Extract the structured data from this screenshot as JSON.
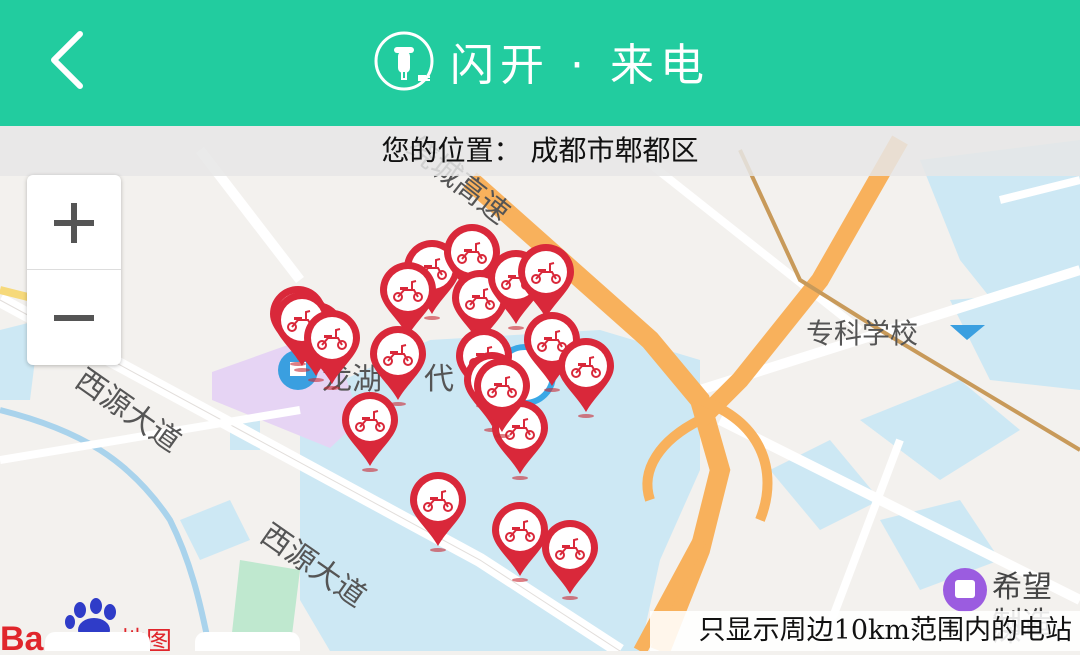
{
  "header": {
    "title": "闪开 · 来电",
    "back_icon": "chevron-left-icon",
    "logo_icon": "scooter-plug-logo",
    "background": "#22cc9f"
  },
  "location": {
    "label": "您的位置：",
    "value": "成都市郫都区",
    "full": "您的位置： 成都市郫都区"
  },
  "zoom": {
    "in_label": "+",
    "out_label": "−"
  },
  "map": {
    "labels": {
      "highway": "绕城高速",
      "road1": "西源大道",
      "road2": "西源大道",
      "school": "专科学校",
      "poi1": "龙湖",
      "poi1b": "代",
      "store_a": "希望深",
      "store_b": "制造有"
    },
    "pin_color": "#d9283a",
    "station_count": 21
  },
  "footer": {
    "note": "只显示周边10km范围内的电站"
  },
  "brand": {
    "name": "Baidu",
    "suffix": "地图"
  }
}
